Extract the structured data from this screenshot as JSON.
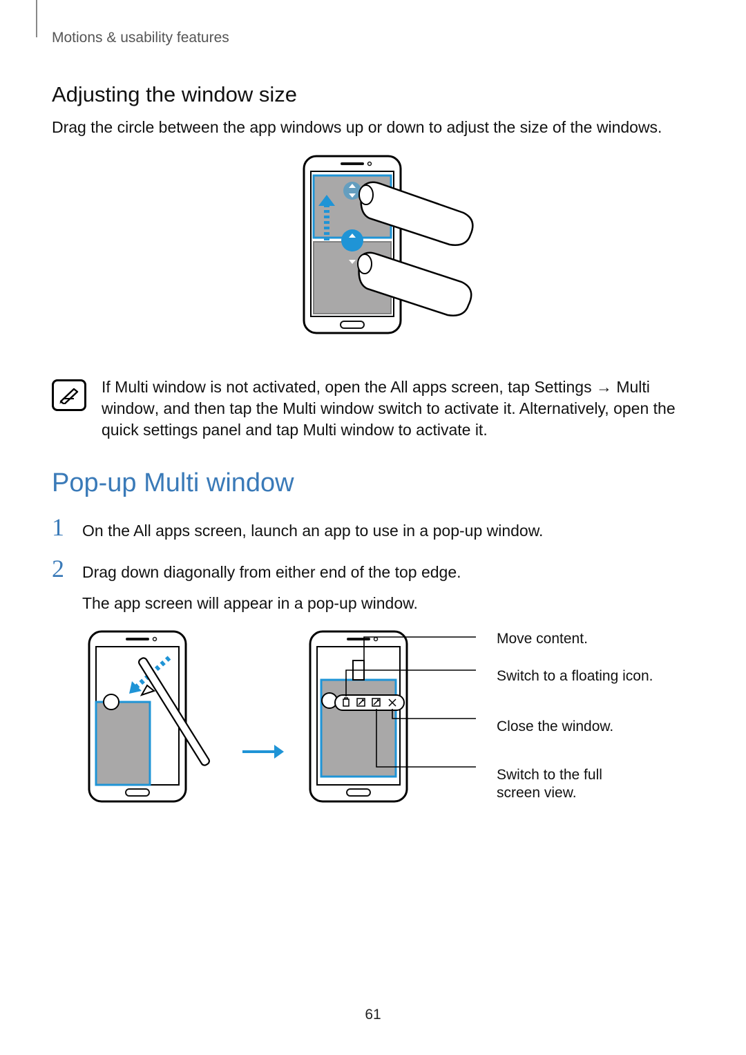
{
  "breadcrumb": "Motions & usability features",
  "section1": {
    "heading": "Adjusting the window size",
    "body": "Drag the circle between the app windows up or down to adjust the size of the windows."
  },
  "note": {
    "parts": [
      "If Multi window is not activated, open the All apps screen, tap ",
      "Settings",
      " → ",
      "Multi window",
      ", and then tap the ",
      "Multi window",
      " switch to activate it. Alternatively, open the quick settings panel and tap ",
      "Multi window",
      " to activate it."
    ]
  },
  "section2": {
    "heading": "Pop-up Multi window",
    "steps": [
      {
        "num": "1",
        "text": "On the All apps screen, launch an app to use in a pop-up window."
      },
      {
        "num": "2",
        "text": "Drag down diagonally from either end of the top edge.",
        "text2": "The app screen will appear in a pop-up window."
      }
    ],
    "callouts": [
      "Move content.",
      "Switch to a floating icon.",
      "Close the window.",
      "Switch to the full screen view."
    ]
  },
  "page_number": "61"
}
